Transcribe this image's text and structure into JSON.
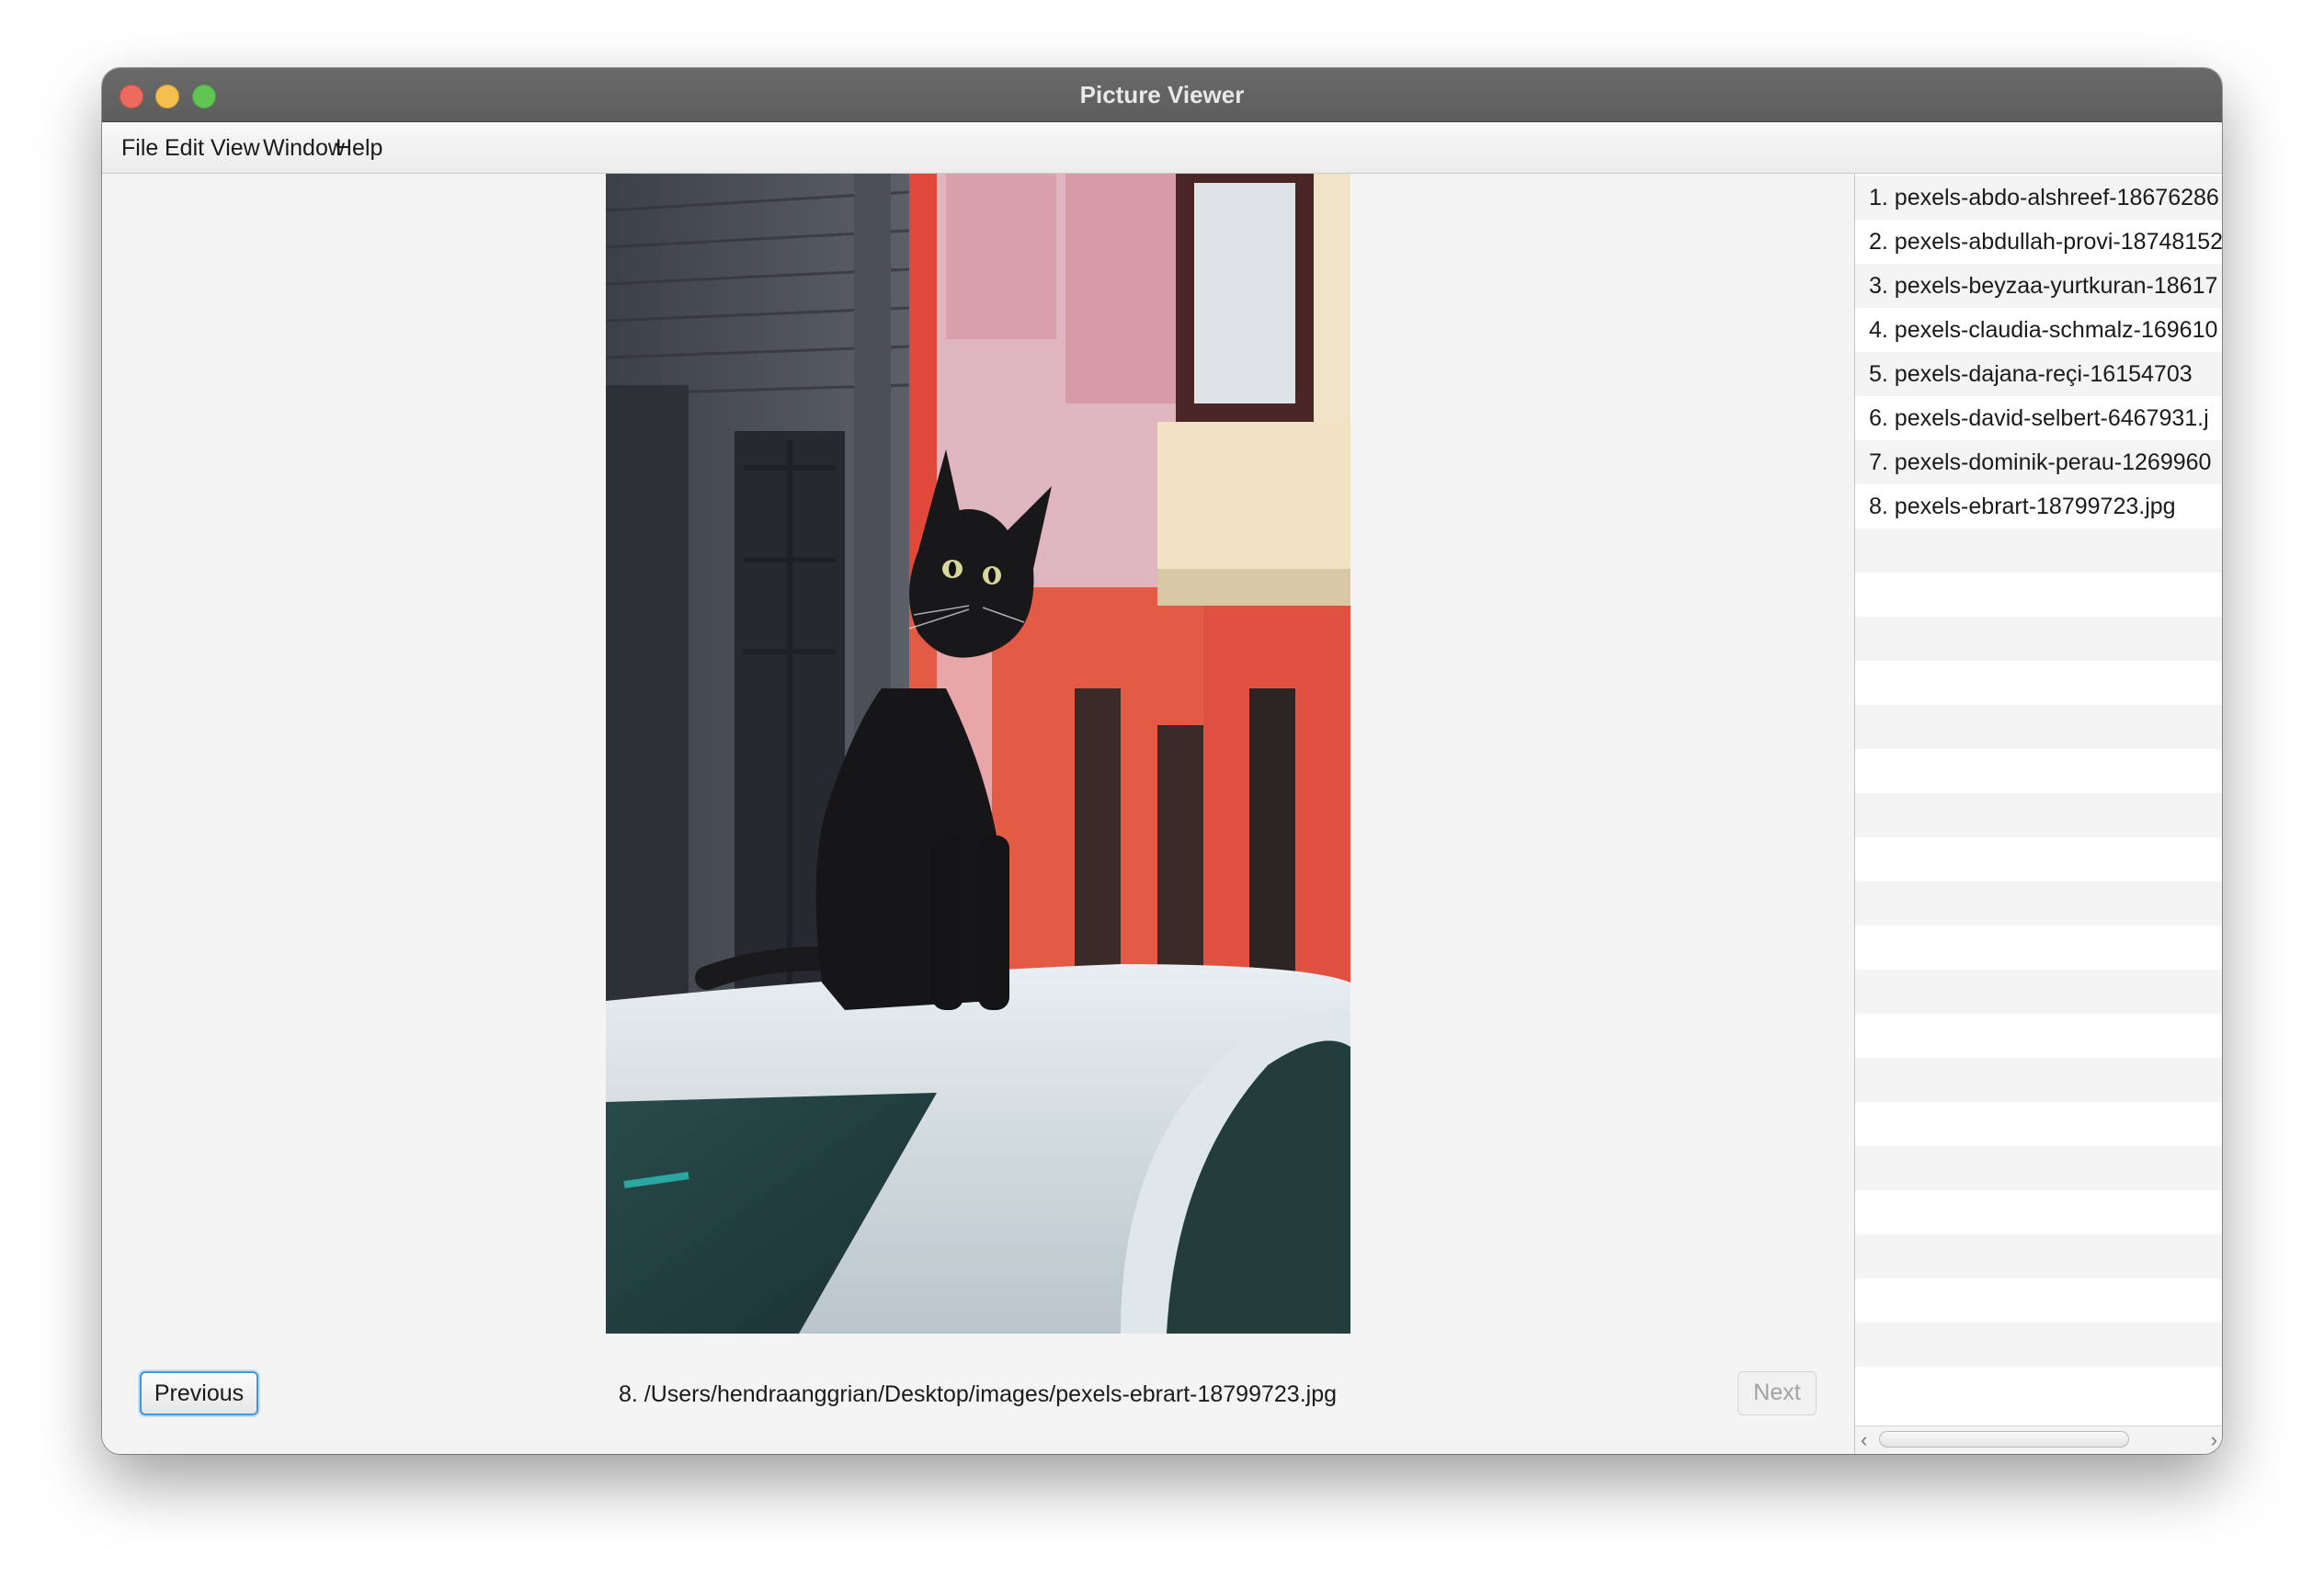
{
  "window": {
    "title": "Picture Viewer"
  },
  "menu": [
    "File",
    "Edit",
    "View",
    "Window",
    "Help"
  ],
  "viewer": {
    "image_label": "8. /Users/hendraanggrian/Desktop/images/pexels-ebrart-18799723.jpg",
    "previous_label": "Previous",
    "next_label": "Next",
    "next_enabled": false
  },
  "file_list": {
    "items": [
      "1. pexels-abdo-alshreef-18676286",
      "2. pexels-abdullah-provi-18748152",
      "3. pexels-beyzaa-yurtkuran-18617",
      "4. pexels-claudia-schmalz-169610",
      "5. pexels-dajana-reçi-16154703",
      "6. pexels-david-selbert-6467931.j",
      "7. pexels-dominik-perau-1269960",
      "8. pexels-ebrart-18799723.jpg"
    ],
    "empty_rows": 20
  },
  "colors": {
    "focus_ring": "#3b97de",
    "titlebar": "#616161",
    "close": "#ed6a5e",
    "minimize": "#f5bf4f",
    "maximize": "#61c554"
  }
}
